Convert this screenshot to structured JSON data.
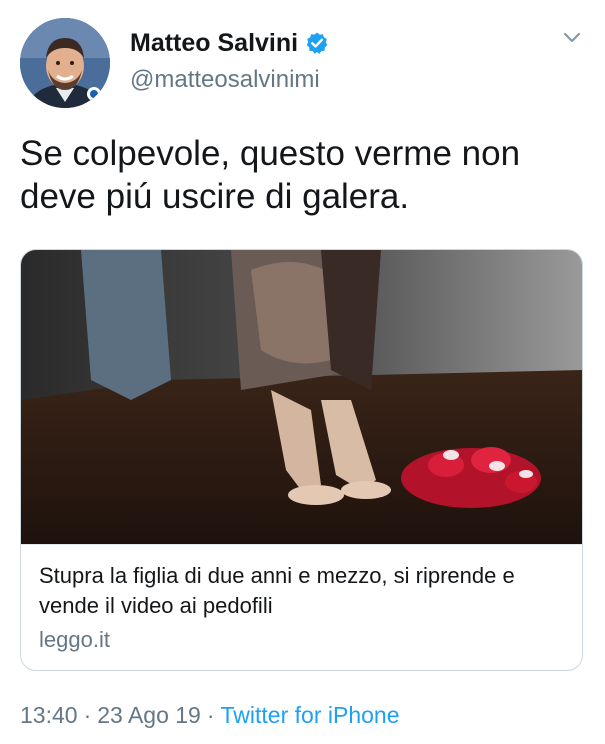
{
  "user": {
    "display_name": "Matteo Salvini",
    "handle": "@matteosalvinimi",
    "verified": true
  },
  "tweet": {
    "text": "Se colpevole, questo verme non\ndeve piú uscire di galera."
  },
  "card": {
    "title": "Stupra la figlia di due anni e mezzo, si riprende e vende il video ai pedofili",
    "domain": "leggo.it"
  },
  "meta": {
    "time": "13:40",
    "date": "23 Ago 19",
    "separator": "·",
    "source": "Twitter for iPhone"
  },
  "colors": {
    "link": "#1da1f2",
    "secondary_text": "#657786",
    "primary_text": "#14171a",
    "border": "#ccd6dd"
  },
  "icons": [
    "verified-badge-icon",
    "chevron-down-icon"
  ]
}
